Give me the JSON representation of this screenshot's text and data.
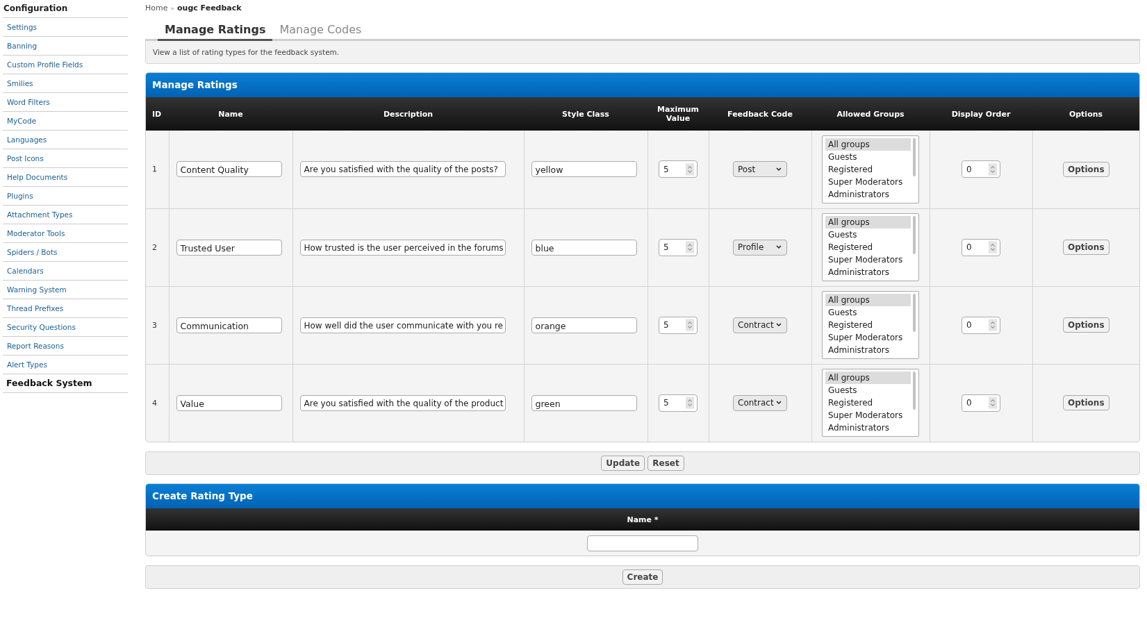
{
  "sidebar": {
    "title": "Configuration",
    "items": [
      {
        "label": "Settings",
        "selected": false
      },
      {
        "label": "Banning",
        "selected": false
      },
      {
        "label": "Custom Profile Fields",
        "selected": false
      },
      {
        "label": "Smilies",
        "selected": false
      },
      {
        "label": "Word Filters",
        "selected": false
      },
      {
        "label": "MyCode",
        "selected": false
      },
      {
        "label": "Languages",
        "selected": false
      },
      {
        "label": "Post Icons",
        "selected": false
      },
      {
        "label": "Help Documents",
        "selected": false
      },
      {
        "label": "Plugins",
        "selected": false
      },
      {
        "label": "Attachment Types",
        "selected": false
      },
      {
        "label": "Moderator Tools",
        "selected": false
      },
      {
        "label": "Spiders / Bots",
        "selected": false
      },
      {
        "label": "Calendars",
        "selected": false
      },
      {
        "label": "Warning System",
        "selected": false
      },
      {
        "label": "Thread Prefixes",
        "selected": false
      },
      {
        "label": "Security Questions",
        "selected": false
      },
      {
        "label": "Report Reasons",
        "selected": false
      },
      {
        "label": "Alert Types",
        "selected": false
      },
      {
        "label": "Feedback System",
        "selected": true
      }
    ]
  },
  "breadcrumb": {
    "items": [
      "Home",
      "ougc Feedback"
    ],
    "separator": "»"
  },
  "tabs": [
    {
      "label": "Manage Ratings",
      "selected": true
    },
    {
      "label": "Manage Codes",
      "selected": false
    }
  ],
  "description": "View a list of rating types for the feedback system.",
  "ratings_table": {
    "title": "Manage Ratings",
    "columns": [
      "ID",
      "Name",
      "Description",
      "Style Class",
      "Maximum Value",
      "Feedback Code",
      "Allowed Groups",
      "Display Order",
      "Options"
    ],
    "rows": [
      {
        "id": "1",
        "name": "Content Quality",
        "description": "Are you satisfied with the quality of the posts?",
        "style_class": "yellow",
        "maximum_value": "5",
        "feedback_code": "Post",
        "groups": [
          {
            "label": "All groups",
            "selected": true
          },
          {
            "label": "Guests",
            "selected": false
          },
          {
            "label": "Registered",
            "selected": false
          },
          {
            "label": "Super Moderators",
            "selected": false
          },
          {
            "label": "Administrators",
            "selected": false
          }
        ],
        "display_order": "0",
        "options": "Options"
      },
      {
        "id": "2",
        "name": "Trusted User",
        "description": "How trusted is the user perceived in the forums",
        "style_class": "blue",
        "maximum_value": "5",
        "feedback_code": "Profile",
        "groups": [
          {
            "label": "All groups",
            "selected": true
          },
          {
            "label": "Guests",
            "selected": false
          },
          {
            "label": "Registered",
            "selected": false
          },
          {
            "label": "Super Moderators",
            "selected": false
          },
          {
            "label": "Administrators",
            "selected": false
          }
        ],
        "display_order": "0",
        "options": "Options"
      },
      {
        "id": "3",
        "name": "Communication",
        "description": "How well did the user communicate with you re",
        "style_class": "orange",
        "maximum_value": "5",
        "feedback_code": "Contract",
        "groups": [
          {
            "label": "All groups",
            "selected": true
          },
          {
            "label": "Guests",
            "selected": false
          },
          {
            "label": "Registered",
            "selected": false
          },
          {
            "label": "Super Moderators",
            "selected": false
          },
          {
            "label": "Administrators",
            "selected": false
          }
        ],
        "display_order": "0",
        "options": "Options"
      },
      {
        "id": "4",
        "name": "Value",
        "description": "Are you satisfied with the quality of the product",
        "style_class": "green",
        "maximum_value": "5",
        "feedback_code": "Contract",
        "groups": [
          {
            "label": "All groups",
            "selected": true
          },
          {
            "label": "Guests",
            "selected": false
          },
          {
            "label": "Registered",
            "selected": false
          },
          {
            "label": "Super Moderators",
            "selected": false
          },
          {
            "label": "Administrators",
            "selected": false
          }
        ],
        "display_order": "0",
        "options": "Options"
      }
    ]
  },
  "ratings_buttons": [
    "Update",
    "Reset"
  ],
  "create_table": {
    "title": "Create Rating Type",
    "columns": [
      "Name *"
    ]
  },
  "create_buttons": [
    "Create"
  ]
}
